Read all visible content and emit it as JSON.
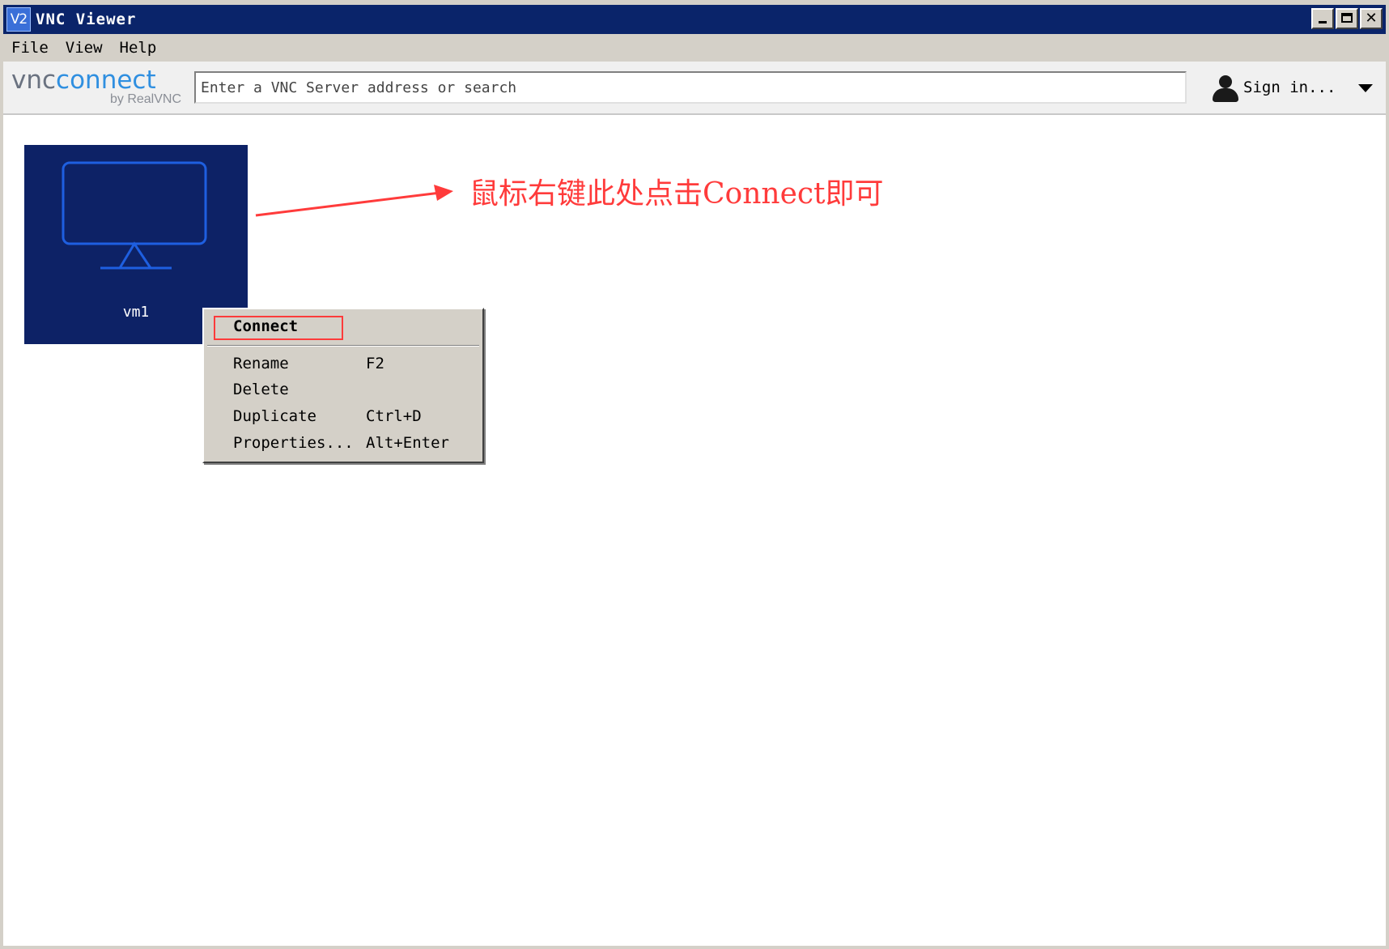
{
  "window": {
    "title": "VNC Viewer",
    "icon_text": "V2",
    "controls": [
      "minimize",
      "maximize",
      "close"
    ]
  },
  "menubar": {
    "items": [
      "File",
      "View",
      "Help"
    ]
  },
  "toolbar": {
    "logo_main_vnc": "vnc",
    "logo_main_connect": "connect",
    "logo_sub": "by RealVNC",
    "search_placeholder": "Enter a VNC Server address or search",
    "search_value": "",
    "signin_label": "Sign in..."
  },
  "tiles": [
    {
      "label": "vm1"
    }
  ],
  "annotation": {
    "text": "鼠标右键此处点击Connect即可",
    "color": "#ff3b3b"
  },
  "context_menu": {
    "items": [
      {
        "label": "Connect",
        "shortcut": "",
        "highlighted": true
      },
      {
        "label": "Rename",
        "shortcut": "F2"
      },
      {
        "label": "Delete",
        "shortcut": ""
      },
      {
        "label": "Duplicate",
        "shortcut": "Ctrl+D"
      },
      {
        "label": "Properties...",
        "shortcut": "Alt+Enter"
      }
    ]
  },
  "colors": {
    "titlebar": "#0a246a",
    "tile_bg": "#0d2266",
    "monitor_outline": "#1e5fe0",
    "accent_red": "#ff3b3b",
    "chrome": "#d4d0c8"
  }
}
